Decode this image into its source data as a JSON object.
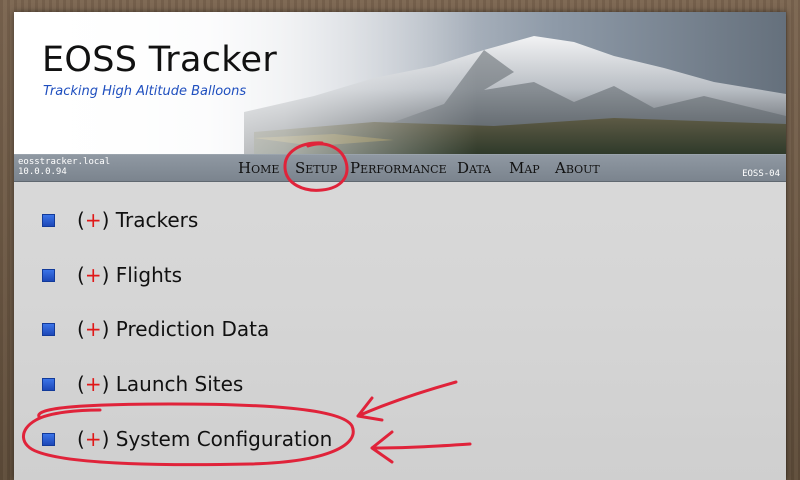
{
  "banner": {
    "title": "EOSS Tracker",
    "subtitle": "Tracking High Altitude Balloons"
  },
  "navbar": {
    "hostname": "eosstracker.local",
    "ip": "10.0.0.94",
    "version": "EOSS-04",
    "links": [
      {
        "label": "Home"
      },
      {
        "label": "Setup"
      },
      {
        "label": "Performance"
      },
      {
        "label": "Data"
      },
      {
        "label": "Map"
      },
      {
        "label": "About"
      }
    ]
  },
  "sections": [
    {
      "toggle": "+",
      "label": "Trackers"
    },
    {
      "toggle": "+",
      "label": "Flights"
    },
    {
      "toggle": "+",
      "label": "Prediction Data"
    },
    {
      "toggle": "+",
      "label": "Launch Sites"
    },
    {
      "toggle": "+",
      "label": "System Configuration"
    }
  ],
  "colors": {
    "accent_bullet": "#2b5fd6",
    "toggle": "#e01818",
    "annotation": "#e0233a",
    "subtitle": "#1f4fbf"
  }
}
